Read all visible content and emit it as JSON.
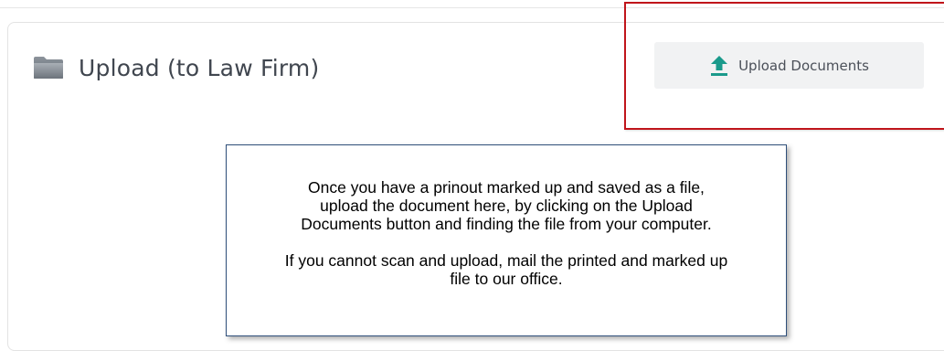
{
  "section": {
    "title": "Upload (to Law Firm)",
    "title_icon": "folder-icon"
  },
  "upload_button": {
    "label": "Upload Documents",
    "icon": "upload-icon",
    "icon_color": "#1a9a8b"
  },
  "highlight": {
    "color": "#c0151b"
  },
  "callout": {
    "paragraph1": [
      "Once you have a prinout marked up and saved as a file,",
      "upload the document here, by clicking on the Upload",
      "Documents button and finding the file from your computer."
    ],
    "paragraph2": [
      "If you cannot scan and upload, mail the printed and marked up",
      "file to our office."
    ]
  }
}
